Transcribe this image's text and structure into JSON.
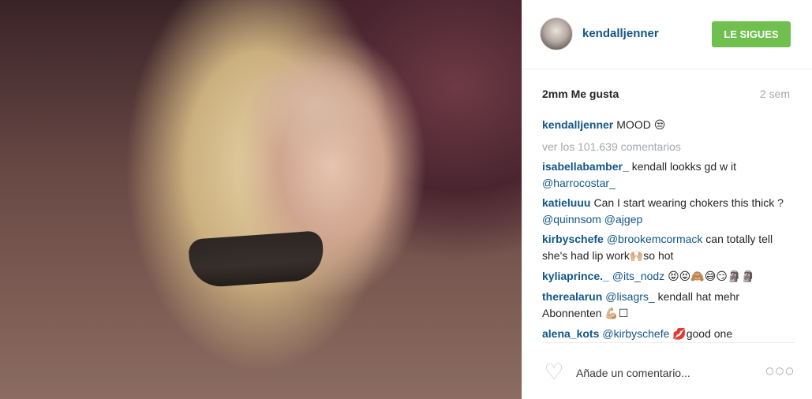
{
  "post": {
    "image_alt": "portrait photo"
  },
  "header": {
    "username": "kendalljenner",
    "follow_label": "LE SIGUES",
    "follow_color": "#70c050"
  },
  "stats": {
    "likes": "2mm Me gusta",
    "time": "2 sem"
  },
  "caption": {
    "user": "kendalljenner",
    "text": "MOOD",
    "emoji": "😒"
  },
  "view_comments": "ver los 101.639 comentarios",
  "comments": [
    {
      "user": "isabellabamber_",
      "text": "kendall lookks gd w it",
      "mention": "@harrocostar_"
    },
    {
      "user": "katieluuu",
      "text": "Can I start wearing chokers this thick ?",
      "mention": "@quinnsom @ajgep"
    },
    {
      "user": "kirbyschefe",
      "mention": "@brookemcormack",
      "text": "can totally tell she's had lip work",
      "emoji": "🙌🏼",
      "text2": "so hot"
    },
    {
      "user": "kyliaprince._",
      "mention": "@its_nodz",
      "emoji": "😝😝🙈😅😏🗿🗿"
    },
    {
      "user": "therealarun",
      "mention": "@lisagrs_",
      "text": "kendall hat mehr Abonnenten",
      "emoji": "💪🏼☐"
    },
    {
      "user": "alena_kots",
      "mention": "@kirbyschefe",
      "emoji": "💋",
      "text": "good one"
    }
  ],
  "footer": {
    "heart_icon": "heart-outline-icon",
    "comment_placeholder": "Añade un comentario...",
    "options_icon": "more-options-icon",
    "options_glyph": "○○○"
  },
  "colors": {
    "link": "#125688",
    "muted": "#a5a7aa"
  }
}
